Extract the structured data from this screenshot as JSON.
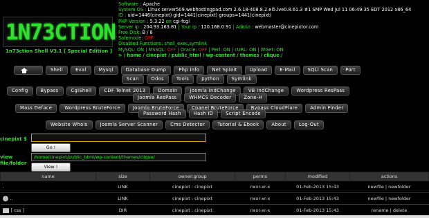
{
  "logo": {
    "title": "1N73CTION",
    "subtitle": "1n73ction Shell V3.1 [ Special Edition ]"
  },
  "info": {
    "software_k": "Software : ",
    "software_v": "Apache",
    "os_k": "System OS : ",
    "os_v": "Linux server509.webhostingpad.com 2.6.18-408.8.2.el5.lve0.8.61.3 #1 SMP Wed Jul 11 06:49:35 EDT 2012 x86_64",
    "id_k": "ID : ",
    "id_v": "uid=1446(cinepixt) gid=1441(cinepixt) groups=1441(cinepixt)",
    "php_k": "PHP Version : ",
    "php_v": "5.3.22",
    "php_on": " on ",
    "php_cgi": "cgi-fcgi",
    "ip_k": "Server ip : ",
    "ip_v": "204.93.163.81",
    "ip_your": " | Your ip : ",
    "ip_your_v": "120.168.0.91",
    "admin_k": " | Admin : ",
    "admin_v": "webmaster@cinepixtor.com",
    "disk_k": "Free Disk: ",
    "disk_v": "B / 8",
    "safe_k": "Safemode: ",
    "safe_v": "OFF",
    "dis_k": "Disabled Functions: ",
    "dis_v": "shell_exec,symlink",
    "mysql_k": "MySQL: ",
    "mysql_v": "ON",
    "mssql_k": " | MSSQL: ",
    "mssql_v": "OFF",
    "oracle_k": " | Oracle: ",
    "oracle_v": "OFF",
    "perl_k": " | Perl: ",
    "perl_v": "ON",
    "curl_k": " | cURL: ",
    "curl_v": "ON",
    "wget_k": " | WGet: ",
    "wget_v": "ON",
    "path": ">  / home / cinepixt / public_html / wp-content / themes / clique /"
  },
  "menu": {
    "row1": [
      "Shell",
      "Eval",
      "Mysql",
      "Database Dump",
      "Php Info",
      "Net Sploit",
      "Upload",
      "E-Mail",
      "SQLi Scan",
      "Port"
    ],
    "row2": [
      "Scan",
      "Ddos",
      "Tools",
      "python",
      "Symlink"
    ],
    "row3": [
      "Config",
      "Bypass",
      "CgiShell",
      "CDF Telnet 2013",
      "Domain",
      "Joomla IndChange",
      "VB IndChange",
      "Wordpress ResPass"
    ],
    "row4": [
      "Joomla ResPass",
      "WHMCS Decoder",
      "Zone-H"
    ],
    "row5": [
      "Mass Deface",
      "Wordpress BruteForce",
      "Joomla BruteForce",
      "Cpanel BruteForce",
      "Bypass CloudFlare",
      "Admin Finder"
    ],
    "row6": [
      "Password Hash",
      "Hash ID",
      "Script Encode"
    ],
    "row7": [
      "Website Whois",
      "Joomla Server Scanner",
      "Cms Detector",
      "Tutorial & Ebook",
      "About",
      "Log-Out"
    ]
  },
  "cmd": {
    "label": "cinepixt $",
    "button": "Go !"
  },
  "view": {
    "label1": "view",
    "label2": "file/folder",
    "value": "/home/cinepixt/public_html/wp-content/themes/clique/",
    "button": "View !"
  },
  "table": {
    "headers": [
      "name",
      "size",
      "owner:group",
      "perms",
      "modified",
      "actions"
    ],
    "rows": [
      {
        "name": ".",
        "size": "LINK",
        "owner": "cinepixt : cinepixt",
        "perms": "rwxr-xr-x",
        "modified": "01-Feb-2013 15:43",
        "actions": "newfile | newfolder"
      },
      {
        "name": "..",
        "size": "LINK",
        "owner": "cinepixt : cinepixt",
        "perms": "rwxr-xr-x",
        "modified": "01-Feb-2013 15:43",
        "actions": "newfile | newfolder"
      },
      {
        "name": "[ css ]",
        "size": "DIR",
        "owner": "cinepixt : cinepixt",
        "perms": "rwxr-xr-x",
        "modified": "01-Feb-2013 15:43",
        "actions": "rename | delete"
      }
    ]
  }
}
